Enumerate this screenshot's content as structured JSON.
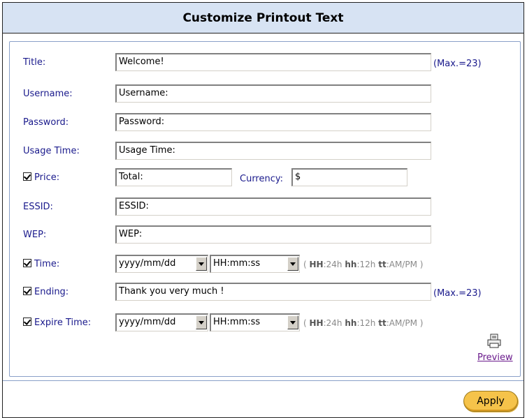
{
  "header": {
    "title": "Customize Printout Text"
  },
  "fields": {
    "title": {
      "label": "Title:",
      "value": "Welcome!",
      "max": "(Max.=23)"
    },
    "username": {
      "label": "Username:",
      "value": "Username:"
    },
    "password": {
      "label": "Password:",
      "value": "Password:"
    },
    "usage_time": {
      "label": "Usage Time:",
      "value": "Usage Time:"
    },
    "price": {
      "label": "Price:",
      "checked": true,
      "value": "Total:",
      "currency_label": "Currency:",
      "currency_value": "$"
    },
    "essid": {
      "label": "ESSID:",
      "value": "ESSID:"
    },
    "wep": {
      "label": "WEP:",
      "value": "WEP:"
    },
    "time": {
      "label": "Time:",
      "checked": true,
      "date_format": "yyyy/mm/dd",
      "time_format": "HH:mm:ss"
    },
    "ending": {
      "label": "Ending:",
      "checked": true,
      "value": "Thank you very much !",
      "max": "(Max.=23)"
    },
    "expire_time": {
      "label": "Expire Time:",
      "checked": true,
      "date_format": "yyyy/mm/dd",
      "time_format": "HH:mm:ss"
    }
  },
  "format_hint": {
    "open": "(",
    "hh24": "HH",
    "hh24_text": ":24h",
    "hh12": "hh",
    "hh12_text": ":12h",
    "tt": "tt",
    "tt_text": ":AM/PM",
    "close": ")"
  },
  "actions": {
    "preview_label": "Preview",
    "apply_label": "Apply"
  }
}
